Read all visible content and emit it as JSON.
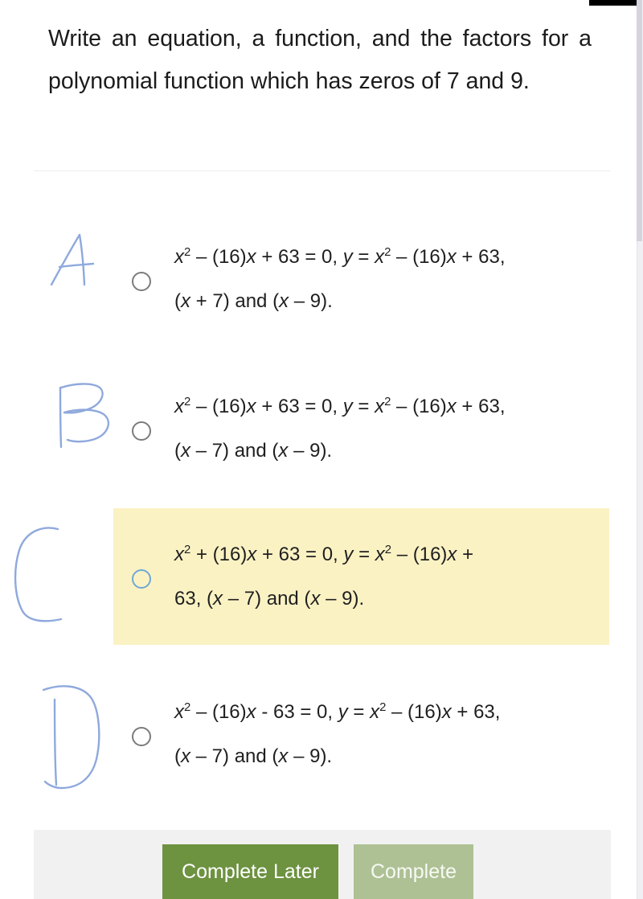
{
  "question": {
    "text": "Write an equation, a function, and the factors for a polynomial function which has zeros of 7 and 9."
  },
  "options": [
    {
      "letter": "A",
      "annotation_letter": "A",
      "line1_html": "<i>x</i><sup>2</sup> – (16)<i>x</i> + 63 = 0, <i>y</i> = <i>x</i><sup>2</sup> – (16)<i>x</i> + 63,",
      "line2_html": "(<i>x</i> + 7) and (<i>x</i> – 9).",
      "plain": "x2 – (16)x + 63 = 0, y = x2 – (16)x + 63, (x + 7) and (x – 9).",
      "selected": false,
      "highlighted": false
    },
    {
      "letter": "B",
      "annotation_letter": "B",
      "line1_html": "<i>x</i><sup>2</sup> – (16)<i>x</i> + 63 = 0, <i>y</i> = <i>x</i><sup>2</sup> – (16)<i>x</i> + 63,",
      "line2_html": "(<i>x</i> – 7) and (<i>x</i> – 9).",
      "plain": "x2 – (16)x + 63 = 0, y = x2 – (16)x + 63, (x – 7) and (x – 9).",
      "selected": false,
      "highlighted": false
    },
    {
      "letter": "C",
      "annotation_letter": "C",
      "line1_html": "<i>x</i><sup>2</sup> + (16)<i>x</i> + 63 = 0, <i>y</i> = <i>x</i><sup>2</sup> – (16)<i>x</i> +",
      "line2_html": "63, (<i>x</i> – 7) and (<i>x</i> – 9).",
      "plain": "x2 + (16)x + 63 = 0, y = x2 – (16)x + 63, (x – 7) and (x – 9).",
      "selected": false,
      "highlighted": true
    },
    {
      "letter": "D",
      "annotation_letter": "D",
      "line1_html": "<i>x</i><sup>2</sup> – (16)<i>x</i> - 63 = 0, <i>y</i> = <i>x</i><sup>2</sup> – (16)<i>x</i> + 63,",
      "line2_html": "(<i>x</i> – 7) and (<i>x</i> – 9).",
      "plain": "x2 – (16)x - 63 = 0, y = x2 – (16)x + 63, (x – 7) and (x – 9).",
      "selected": false,
      "highlighted": false
    }
  ],
  "footer": {
    "complete_later_label": "Complete Later",
    "complete_label": "Complete"
  },
  "colors": {
    "highlight_background": "#fbf2c4",
    "primary_button": "#6d9240",
    "disabled_button": "#aec194",
    "footer_background": "#f1f1f1",
    "radio_default": "#7b7b7b",
    "radio_highlight": "#6fa8d4",
    "annotation_ink": "#8fa9dd"
  }
}
